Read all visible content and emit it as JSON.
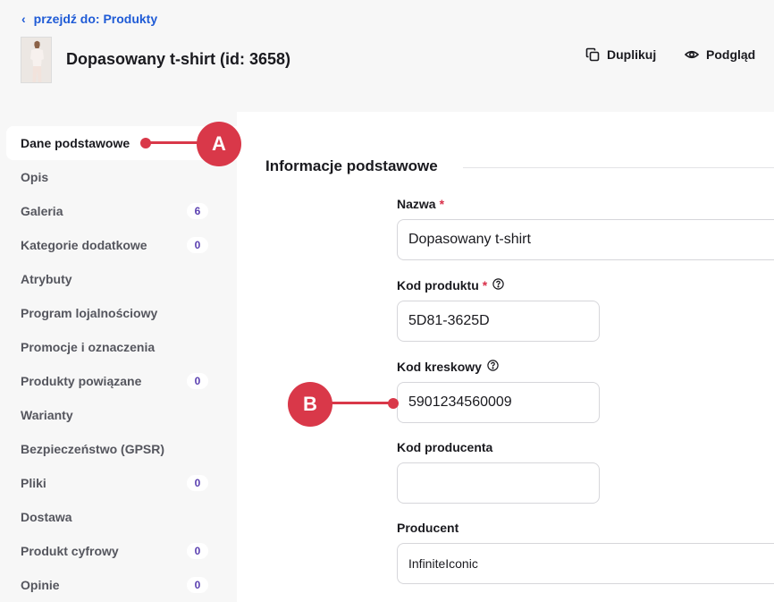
{
  "header": {
    "back_link": "przejdź do: Produkty",
    "title": "Dopasowany t-shirt (id: 3658)",
    "duplicate_label": "Duplikuj",
    "preview_label": "Podgląd"
  },
  "sidebar": {
    "items": [
      {
        "label": "Dane podstawowe",
        "badge": null,
        "active": true
      },
      {
        "label": "Opis",
        "badge": null
      },
      {
        "label": "Galeria",
        "badge": "6"
      },
      {
        "label": "Kategorie dodatkowe",
        "badge": "0"
      },
      {
        "label": "Atrybuty",
        "badge": null
      },
      {
        "label": "Program lojalnościowy",
        "badge": null
      },
      {
        "label": "Promocje i oznaczenia",
        "badge": null
      },
      {
        "label": "Produkty powiązane",
        "badge": "0"
      },
      {
        "label": "Warianty",
        "badge": null
      },
      {
        "label": "Bezpieczeństwo (GPSR)",
        "badge": null
      },
      {
        "label": "Pliki",
        "badge": "0"
      },
      {
        "label": "Dostawa",
        "badge": null
      },
      {
        "label": "Produkt cyfrowy",
        "badge": "0"
      },
      {
        "label": "Opinie",
        "badge": "0"
      }
    ]
  },
  "section": {
    "title": "Informacje podstawowe"
  },
  "form": {
    "name": {
      "label": "Nazwa",
      "required": "*",
      "value": "Dopasowany t-shirt"
    },
    "product_code": {
      "label": "Kod produktu",
      "required": "*",
      "value": "5D81-3625D"
    },
    "barcode": {
      "label": "Kod kreskowy",
      "value": "5901234560009"
    },
    "producer_code": {
      "label": "Kod producenta",
      "value": ""
    },
    "producer": {
      "label": "Producent",
      "value": "InfiniteIconic"
    }
  },
  "callouts": {
    "a": "A",
    "b": "B"
  },
  "colors": {
    "accent_link": "#1f5bd6",
    "callout": "#d93849",
    "badge_text": "#5a3fb0"
  }
}
